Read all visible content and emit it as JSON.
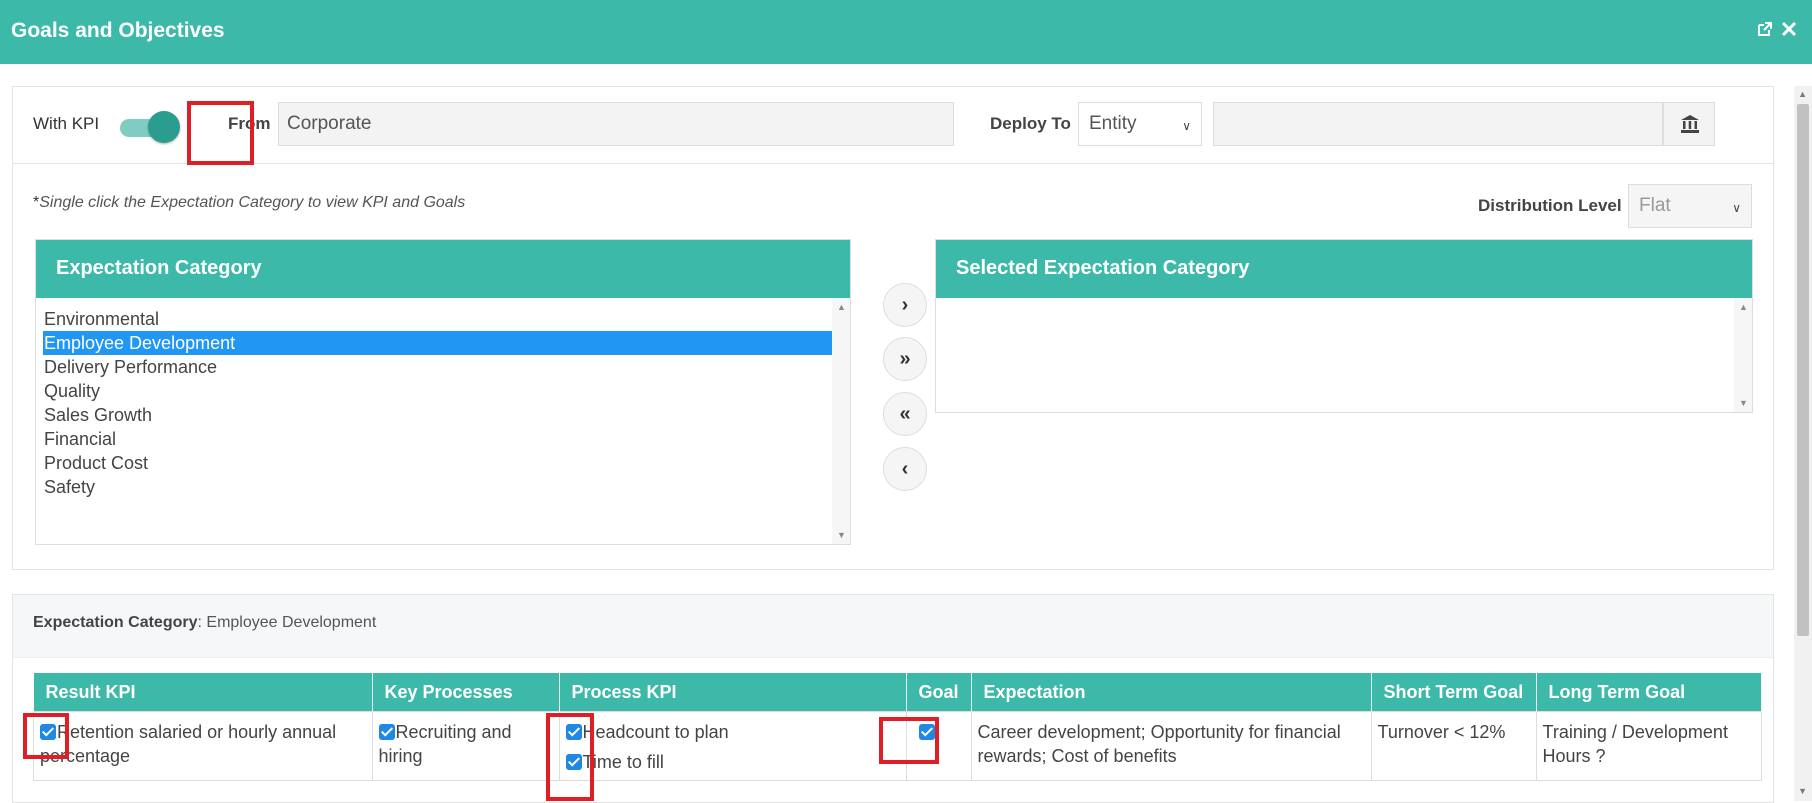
{
  "window": {
    "title": "Goals and Objectives",
    "icons": [
      "external-link-icon",
      "close-icon"
    ]
  },
  "toolbar": {
    "with_kpi_label": "With KPI",
    "with_kpi_on": true,
    "from_label": "From",
    "from_value": "Corporate",
    "deploy_to_label": "Deploy To",
    "deploy_to_value": "Entity",
    "deploy_target_value": "",
    "bank_icon": "bank-icon"
  },
  "hint": {
    "star": "*",
    "text": "Single click the Expectation Category to view KPI and Goals"
  },
  "distribution": {
    "label": "Distribution Level",
    "value": "Flat"
  },
  "expectation_list": {
    "header": "Expectation Category",
    "items": [
      "Environmental",
      "Employee Development",
      "Delivery Performance",
      "Quality",
      "Sales Growth",
      "Financial",
      "Product Cost",
      "Safety"
    ],
    "selected": "Employee Development"
  },
  "move_buttons": [
    "move-right-icon",
    "move-all-right-icon",
    "move-all-left-icon",
    "move-left-icon"
  ],
  "selected_list": {
    "header": "Selected Expectation Category",
    "items": []
  },
  "detail": {
    "category_label": "Expectation Category",
    "category_sep": ":",
    "category_value": "Employee Development"
  },
  "table": {
    "columns": [
      "Result KPI",
      "Key Processes",
      "Process KPI",
      "Goal",
      "Expectation",
      "Short Term Goal",
      "Long Term Goal"
    ],
    "row": {
      "result_kpi": "Retention salaried or hourly annual percentage",
      "key_process": "Recruiting and hiring",
      "process_kpi_1": "Headcount to plan",
      "process_kpi_2": "Time to fill",
      "goal_checked": true,
      "expectation": "Career development; Opportunity for financial rewards; Cost of benefits",
      "short_term_goal": "Turnover < 12%",
      "long_term_goal": "Training / Development Hours ?"
    }
  },
  "colors": {
    "accent": "#3cb9a9",
    "selection": "#2196f3",
    "highlight": "#e01e26",
    "checkbox": "#1e88e5"
  }
}
